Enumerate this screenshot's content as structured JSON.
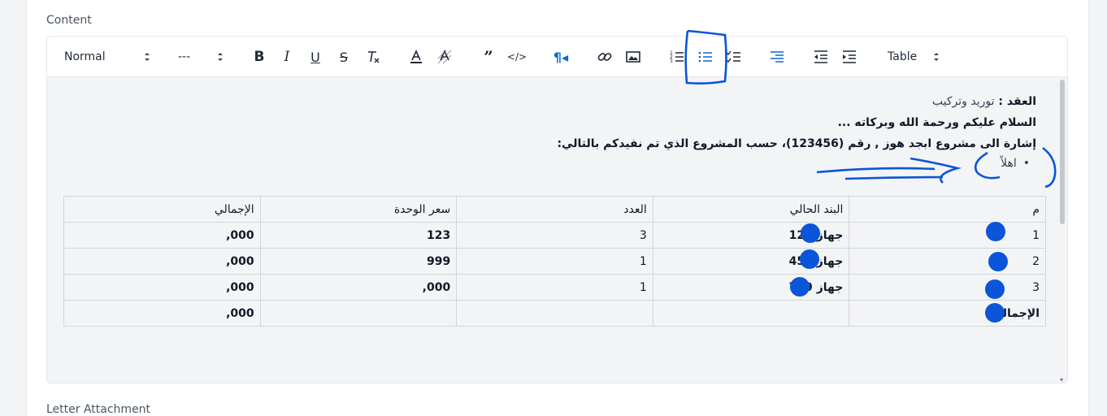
{
  "fields": {
    "content_label": "Content",
    "attachment_label": "Letter Attachment"
  },
  "toolbar": {
    "header_select": "Normal",
    "size_select": "---",
    "table_select": "Table",
    "icons": [
      "bold-icon",
      "italic-icon",
      "underline-icon",
      "strikethrough-icon",
      "clear-format-icon",
      "font-color-icon",
      "background-color-icon",
      "blockquote-icon",
      "code-icon",
      "text-direction-icon",
      "link-icon",
      "image-icon",
      "ordered-list-icon",
      "bullet-list-icon",
      "check-list-icon",
      "align-right-icon",
      "outdent-icon",
      "indent-icon"
    ]
  },
  "document": {
    "contract_label": "العقد :",
    "contract_value": "توريد وتركيب",
    "greeting": "السلام عليكم ورحمة الله وبركاته ...",
    "reference": "إشارة الى مشروع ابجد هوز , رقم (123456)، حسب المشروع الذي تم نفيدكم بالتالي:",
    "bullet_item": "اهلاً"
  },
  "table": {
    "headers": [
      "م",
      "البند الحالي",
      "العدد",
      "سعر الوحدة",
      "الإجمالي"
    ],
    "rows": [
      [
        "1",
        "جهاز 123",
        "3",
        "123",
        "000,"
      ],
      [
        "2",
        "جهاز 456",
        "1",
        "999",
        "000,"
      ],
      [
        "3",
        "جهاز 789",
        "1",
        "000,",
        "000,"
      ],
      [
        "الإجمالي",
        "",
        "",
        "",
        "000,"
      ]
    ]
  },
  "colors": {
    "accent": "#0b66d6",
    "annotation": "#0a55d9"
  }
}
